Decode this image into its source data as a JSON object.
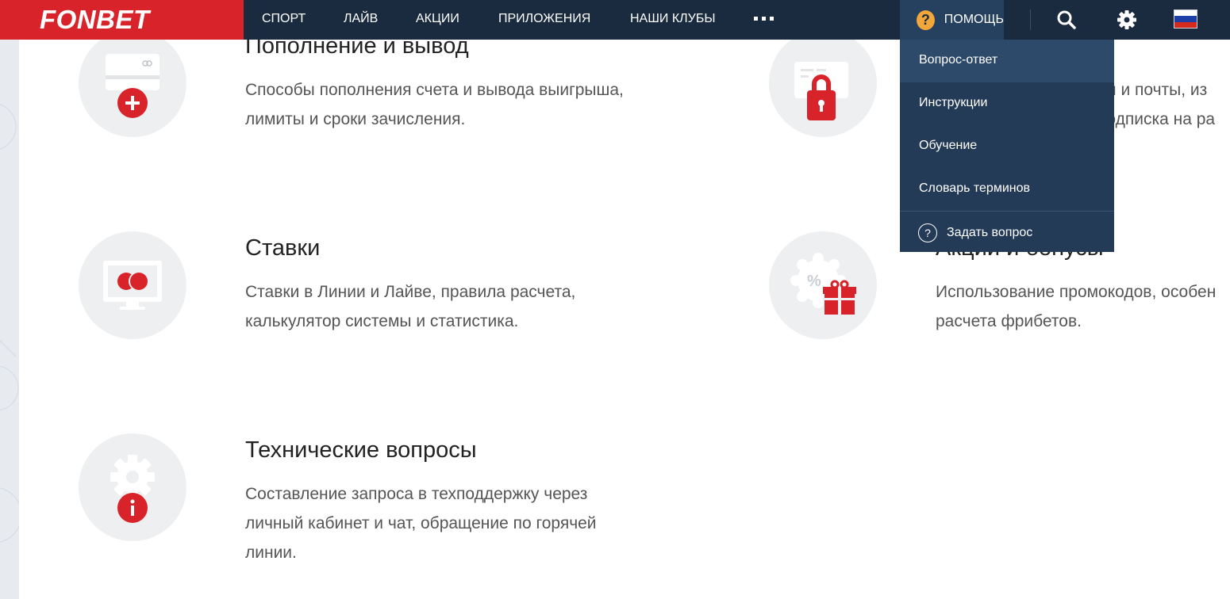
{
  "header": {
    "logo": "FONBET",
    "nav": [
      "СПОРТ",
      "ЛАЙВ",
      "АКЦИИ",
      "ПРИЛОЖЕНИЯ",
      "НАШИ КЛУБЫ"
    ],
    "help_label": "ПОМОЩЬ",
    "help_icon": "?"
  },
  "help_menu": {
    "items": [
      "Вопрос-ответ",
      "Инструкции",
      "Обучение",
      "Словарь терминов"
    ],
    "ask_label": "Задать вопрос",
    "ask_icon": "?"
  },
  "sections": [
    {
      "title": "Пополнение и вывод",
      "desc": [
        "Способы пополнения счета и вывода выигрыша,",
        "лимиты и сроки зачисления."
      ]
    },
    {
      "title": "",
      "desc": [
        "ля и почты, из",
        "подписка на ра"
      ]
    },
    {
      "title": "Ставки",
      "desc": [
        "Ставки в Линии и Лайве, правила расчета,",
        "калькулятор системы и статистика."
      ]
    },
    {
      "title": "Акции и бонусы",
      "desc": [
        "Использование промокодов, особен",
        "расчета фрибетов."
      ]
    },
    {
      "title": "Технические вопросы",
      "desc": [
        "Составление запроса в техподдержку через",
        "личный кабинет и чат, обращение по горячей",
        "линии."
      ]
    }
  ],
  "colors": {
    "topbar": "#1a2b40",
    "logo_bg": "#d8232a",
    "help_bg": "#26405f",
    "dropdown_bg": "#243b57",
    "accent_red": "#d8232a",
    "help_icon_bg": "#f2a73a"
  }
}
